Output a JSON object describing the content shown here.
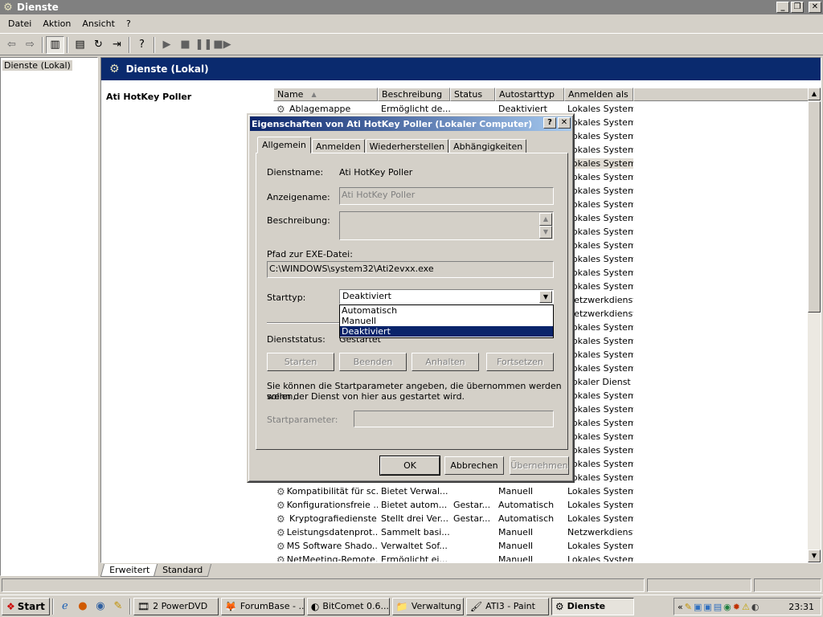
{
  "window": {
    "title": "Dienste",
    "min": "_",
    "max": "❐",
    "close": "✕"
  },
  "menu": [
    "Datei",
    "Aktion",
    "Ansicht",
    "?"
  ],
  "toolbar_icons": [
    "back-arrow",
    "forward-arrow",
    "show-hide-tree",
    "properties",
    "refresh",
    "export-list",
    "help",
    "play",
    "stop",
    "pause",
    "restart"
  ],
  "tree": {
    "root": "Dienste (Lokal)"
  },
  "pane": {
    "header": "Dienste (Lokal)",
    "selected_service": "Ati HotKey Poller"
  },
  "columns": [
    "Name",
    "Beschreibung",
    "Status",
    "Autostarttyp",
    "Anmelden als"
  ],
  "rows": [
    {
      "name": "Ablagemappe",
      "desc": "Ermöglicht de...",
      "status": "",
      "start": "Deaktiviert",
      "logon": "Lokales System"
    },
    {
      "name": "",
      "desc": "",
      "status": "",
      "start": "",
      "logon": "Lokales System"
    },
    {
      "name": "",
      "desc": "",
      "status": "",
      "start": "",
      "logon": "Lokales System"
    },
    {
      "name": "",
      "desc": "",
      "status": "",
      "start": "",
      "logon": "Lokales System"
    },
    {
      "name": "",
      "desc": "",
      "status": "",
      "start": "",
      "logon": "Lokales System",
      "selected": true
    },
    {
      "name": "",
      "desc": "",
      "status": "",
      "start": "",
      "logon": "Lokales System"
    },
    {
      "name": "",
      "desc": "",
      "status": "",
      "start": "",
      "logon": "Lokales System"
    },
    {
      "name": "",
      "desc": "",
      "status": "",
      "start": "",
      "logon": "Lokales System"
    },
    {
      "name": "",
      "desc": "",
      "status": "",
      "start": "",
      "logon": "Lokales System"
    },
    {
      "name": "",
      "desc": "",
      "status": "",
      "start": "",
      "logon": "Lokales System"
    },
    {
      "name": "",
      "desc": "",
      "status": "",
      "start": "",
      "logon": "Lokales System"
    },
    {
      "name": "",
      "desc": "",
      "status": "",
      "start": "",
      "logon": "Lokales System"
    },
    {
      "name": "",
      "desc": "",
      "status": "",
      "start": "",
      "logon": "Lokales System"
    },
    {
      "name": "",
      "desc": "",
      "status": "",
      "start": "",
      "logon": "Lokales System"
    },
    {
      "name": "",
      "desc": "",
      "status": "",
      "start": "",
      "logon": "Netzwerkdienst"
    },
    {
      "name": "",
      "desc": "",
      "status": "",
      "start": "",
      "logon": "Netzwerkdienst"
    },
    {
      "name": "",
      "desc": "",
      "status": "",
      "start": "",
      "logon": "Lokales System"
    },
    {
      "name": "",
      "desc": "",
      "status": "",
      "start": "",
      "logon": "Lokales System"
    },
    {
      "name": "",
      "desc": "",
      "status": "",
      "start": "",
      "logon": "Lokales System"
    },
    {
      "name": "",
      "desc": "",
      "status": "",
      "start": "",
      "logon": "Lokales System"
    },
    {
      "name": "",
      "desc": "",
      "status": "",
      "start": "",
      "logon": "Lokaler Dienst"
    },
    {
      "name": "",
      "desc": "",
      "status": "",
      "start": "",
      "logon": "Lokales System"
    },
    {
      "name": "",
      "desc": "",
      "status": "",
      "start": "",
      "logon": "Lokales System"
    },
    {
      "name": "",
      "desc": "",
      "status": "",
      "start": "",
      "logon": "Lokales System"
    },
    {
      "name": "",
      "desc": "",
      "status": "",
      "start": "",
      "logon": "Lokales System"
    },
    {
      "name": "",
      "desc": "",
      "status": "",
      "start": "",
      "logon": "Lokales System"
    },
    {
      "name": "",
      "desc": "",
      "status": "",
      "start": "",
      "logon": "Lokales System"
    },
    {
      "name": "",
      "desc": "",
      "status": "",
      "start": "",
      "logon": "Lokales System"
    },
    {
      "name": "Kompatibilität für sc...",
      "desc": "Bietet Verwal...",
      "status": "",
      "start": "Manuell",
      "logon": "Lokales System"
    },
    {
      "name": "Konfigurationsfreie ...",
      "desc": "Bietet autom...",
      "status": "Gestar...",
      "start": "Automatisch",
      "logon": "Lokales System"
    },
    {
      "name": "Kryptografiedienste",
      "desc": "Stellt drei Ver...",
      "status": "Gestar...",
      "start": "Automatisch",
      "logon": "Lokales System"
    },
    {
      "name": "Leistungsdatenprot...",
      "desc": "Sammelt basi...",
      "status": "",
      "start": "Manuell",
      "logon": "Netzwerkdienst"
    },
    {
      "name": "MS Software Shado...",
      "desc": "Verwaltet Sof...",
      "status": "",
      "start": "Manuell",
      "logon": "Lokales System"
    },
    {
      "name": "NetMeeting-Remote...",
      "desc": "Ermöglicht ei...",
      "status": "",
      "start": "Manuell",
      "logon": "Lokales System"
    }
  ],
  "bottom_tabs": [
    "Erweitert",
    "Standard"
  ],
  "dialog": {
    "title": "Eigenschaften von Ati HotKey Poller (Lokaler Computer)",
    "help": "?",
    "close": "✕",
    "tabs": [
      "Allgemein",
      "Anmelden",
      "Wiederherstellen",
      "Abhängigkeiten"
    ],
    "dienstname_label": "Dienstname:",
    "dienstname_value": "Ati HotKey Poller",
    "anzeigename_label": "Anzeigename:",
    "anzeigename_value": "Ati HotKey Poller",
    "beschreibung_label": "Beschreibung:",
    "beschreibung_value": "",
    "pfad_label": "Pfad zur EXE-Datei:",
    "pfad_value": "C:\\WINDOWS\\system32\\Ati2evxx.exe",
    "starttyp_label": "Starttyp:",
    "starttyp_value": "Deaktiviert",
    "starttyp_options": [
      "Automatisch",
      "Manuell",
      "Deaktiviert"
    ],
    "dienststatus_label": "Dienststatus:",
    "dienststatus_value": "Gestartet",
    "btn_starten": "Starten",
    "btn_beenden": "Beenden",
    "btn_anhalten": "Anhalten",
    "btn_fortsetzen": "Fortsetzen",
    "hint_line1": "Sie können die Startparameter angeben, die übernommen werden sollen,",
    "hint_line2": "wenn der Dienst von hier aus gestartet wird.",
    "startparam_label": "Startparameter:",
    "startparam_value": "",
    "ok": "OK",
    "abbrechen": "Abbrechen",
    "uebernehmen": "Übernehmen"
  },
  "taskbar": {
    "start": "Start",
    "quicklaunch": [
      "ie-icon",
      "firefox-icon",
      "thunderbird-icon",
      "misc-icon"
    ],
    "buttons": [
      {
        "label": "2 PowerDVD",
        "icon": "🎞",
        "width": 106
      },
      {
        "label": "ForumBase - ...",
        "icon": "🦊",
        "width": 104
      },
      {
        "label": "BitComet 0.6...",
        "icon": "◐",
        "width": 103
      },
      {
        "label": "Verwaltung",
        "icon": "📁",
        "width": 89
      },
      {
        "label": "ATI3 - Paint",
        "icon": "🖌",
        "width": 103
      },
      {
        "label": "Dienste",
        "icon": "⚙",
        "width": 103,
        "active": true
      }
    ],
    "clock": "23:31"
  }
}
